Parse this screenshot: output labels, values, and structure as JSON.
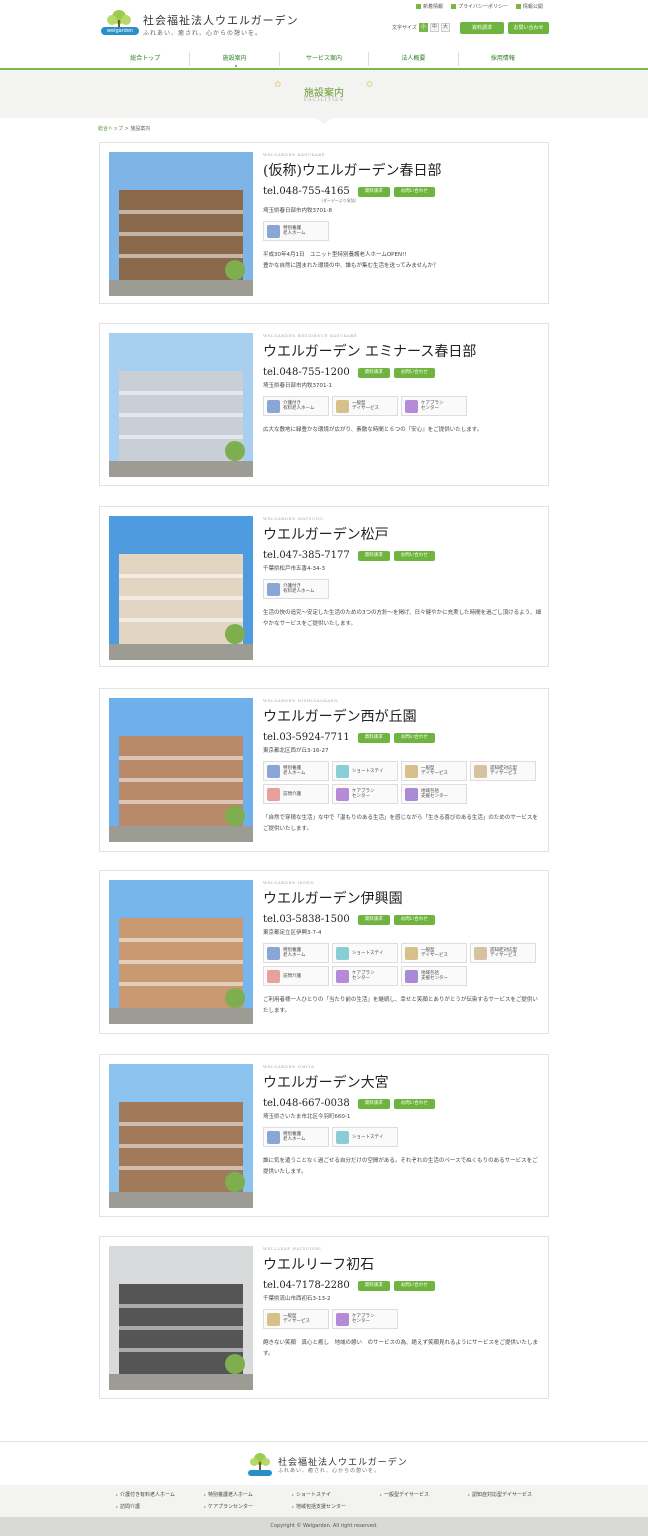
{
  "header": {
    "org_name": "社会福祉法人ウエルガーデン",
    "tagline": "ふれあい、癒され、心からの憩いを。",
    "logo_badge": "welgarden",
    "util_links": [
      "新着情報",
      "プライバシーポリシー",
      "情報公開"
    ],
    "font_size_label": "文字サイズ",
    "font_sizes": [
      "小",
      "中",
      "大"
    ],
    "btn_request": "資料請求",
    "btn_contact": "お問い合わせ",
    "nav": [
      "総合トップ",
      "施設案内",
      "サービス案内",
      "法人概要",
      "採用情報"
    ]
  },
  "page": {
    "title": "施設案内",
    "subtitle": "FACILITIES",
    "breadcrumb_home": "総合トップ",
    "breadcrumb_sep": " > ",
    "breadcrumb_current": "施設案内"
  },
  "buttons": {
    "request": "資料請求",
    "contact": "お問い合わせ"
  },
  "facilities": [
    {
      "en": "WELGARDEN KASUKABE",
      "name": "(仮称)ウエルガーデン春日部",
      "tel": "tel.048-755-4165",
      "note": "（ダーデーより泉誌）",
      "address": "埼玉県春日部市内牧3701-8",
      "services": [
        {
          "label": "特別養護\n老人ホーム",
          "icon": "building-icon",
          "color": "#8aa6d6"
        }
      ],
      "desc": "平成30年4月1日　ユニット型特別養護老人ホームOPEN!!\n豊かな自然に囲まれた環境の中、誰もが集む生活を送ってみませんか？"
    },
    {
      "en": "WELGARDEN RESIDENCE KASUKABE",
      "name": "ウエルガーデン エミナース春日部",
      "tel": "tel.048-755-1200",
      "note": "",
      "address": "埼玉県春日部市内牧3701-1",
      "services": [
        {
          "label": "介護付き\n有料老人ホーム",
          "icon": "care-home-icon",
          "color": "#8aa6d6"
        },
        {
          "label": "一般型\nデイサービス",
          "icon": "day-service-icon",
          "color": "#d7c08a"
        },
        {
          "label": "ケアプラン\nセンター",
          "icon": "care-plan-icon",
          "color": "#b58ad6"
        }
      ],
      "desc": "広大な敷地に緑豊かな環境が広がり、素敵な時間と６つの『安心』をご提供いたします。"
    },
    {
      "en": "WELGARDEN MATSUDO",
      "name": "ウエルガーデン松戸",
      "tel": "tel.047-385-7177",
      "note": "",
      "address": "千葉県松戸市五香4-34-3",
      "services": [
        {
          "label": "介護付き\n有料老人ホーム",
          "icon": "care-home-icon",
          "color": "#8aa6d6"
        }
      ],
      "desc": "生活の快の追究〜安定した生活のための3つの方針〜を掲げ、日々健やかに充実した時間を過ごし頂けるよう、細やかなサービスをご提供いたします。"
    },
    {
      "en": "WELGARDEN NISHIGAOKAEN",
      "name": "ウエルガーデン西が丘園",
      "tel": "tel.03-5924-7711",
      "note": "",
      "address": "東京都北区西が丘3-16-27",
      "services": [
        {
          "label": "特別養護\n老人ホーム",
          "icon": "building-icon",
          "color": "#8aa6d6"
        },
        {
          "label": "ショートステイ",
          "icon": "short-stay-icon",
          "color": "#8acdd6"
        },
        {
          "label": "一般型\nデイサービス",
          "icon": "day-service-icon",
          "color": "#d7c08a"
        },
        {
          "label": "認知症対応型\nデイサービス",
          "icon": "dementia-day-icon",
          "color": "#d6c2a0"
        },
        {
          "label": "訪問介護",
          "icon": "home-visit-icon",
          "color": "#e8a09a"
        },
        {
          "label": "ケアプラン\nセンター",
          "icon": "care-plan-icon",
          "color": "#b58ad6"
        },
        {
          "label": "地域包括\n支援センター",
          "icon": "community-icon",
          "color": "#a88ad6"
        }
      ],
      "desc": "「自然で穿積な生活」な中で「温もりのある生活」を感じながら「生きる喜びのある生活」のためのサービスをご提供いたします。"
    },
    {
      "en": "WELGARDEN IKOEN",
      "name": "ウエルガーデン伊興園",
      "tel": "tel.03-5838-1500",
      "note": "",
      "address": "東京都足立区伊興3-7-4",
      "services": [
        {
          "label": "特別養護\n老人ホーム",
          "icon": "building-icon",
          "color": "#8aa6d6"
        },
        {
          "label": "ショートステイ",
          "icon": "short-stay-icon",
          "color": "#8acdd6"
        },
        {
          "label": "一般型\nデイサービス",
          "icon": "day-service-icon",
          "color": "#d7c08a"
        },
        {
          "label": "認知症対応型\nデイサービス",
          "icon": "dementia-day-icon",
          "color": "#d6c2a0"
        },
        {
          "label": "訪問介護",
          "icon": "home-visit-icon",
          "color": "#e8a09a"
        },
        {
          "label": "ケアプラン\nセンター",
          "icon": "care-plan-icon",
          "color": "#b58ad6"
        },
        {
          "label": "地域包括\n支援センター",
          "icon": "community-icon",
          "color": "#a88ad6"
        }
      ],
      "desc": "ご利用者様一人ひとりの「当たり前の生活」を継続し、幸せと笑顔とありがとうが伝染するサービスをご提供いたします。"
    },
    {
      "en": "WELGARDEN OMIYA",
      "name": "ウエルガーデン大宮",
      "tel": "tel.048-667-0038",
      "note": "",
      "address": "埼玉県さいたま市北区今羽町660-1",
      "services": [
        {
          "label": "特別養護\n老人ホーム",
          "icon": "building-icon",
          "color": "#8aa6d6"
        },
        {
          "label": "ショートステイ",
          "icon": "short-stay-icon",
          "color": "#8acdd6"
        }
      ],
      "desc": "誰に気を遣うことなく過ごせる自分だけの空間がある。それぞれの生活のペースでぬくもりのあるサービスをご提供いたします。"
    },
    {
      "en": "WELLLEAF HATSUISHI",
      "name": "ウエルリーフ初石",
      "tel": "tel.04-7178-2280",
      "note": "",
      "address": "千葉県流山市西初石3-13-2",
      "services": [
        {
          "label": "一般型\nデイサービス",
          "icon": "day-service-icon",
          "color": "#d7c08a"
        },
        {
          "label": "ケアプラン\nセンター",
          "icon": "care-plan-icon",
          "color": "#b58ad6"
        }
      ],
      "desc": "飽きない笑顔　真心と癒し　地域の憩い　のサービスの為、絶えず笑顔見れるようにサービスをご提供いたします。"
    }
  ],
  "footer": {
    "org_name": "社会福祉法人ウエルガーデン",
    "tagline": "ふれあい、癒され、心からの憩いを。",
    "links": [
      "介護付き有料老人ホーム",
      "特別養護老人ホーム",
      "ショートステイ",
      "一般型デイサービス",
      "認知症対応型デイサービス",
      "訪問介護",
      "ケアプランセンター",
      "地域包括支援センター"
    ],
    "copyright": "Copyright © Welgarden. All right reserved."
  },
  "colors": {
    "accent": "#6fb43f",
    "nav_text": "#2f7b26",
    "title_green": "#6b9b2e",
    "band_bg": "#f3f3f1"
  }
}
